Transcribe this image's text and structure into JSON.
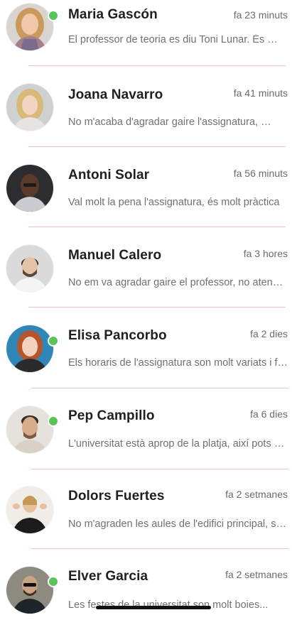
{
  "accent_colors": {
    "online": "#58c558",
    "divider": "#f1c4c4"
  },
  "conversations": [
    {
      "name": "Maria Gascón",
      "time": "fa 23 minuts",
      "preview": "El professor de teoria es diu Toni Lunar. És molt simpàtic",
      "online": true,
      "avatar": "woman-blonde-smiling-avatar"
    },
    {
      "name": "Joana Navarro",
      "time": "fa 41 minuts",
      "preview": "No m'acaba d'agradar gaire l'assignatura, però és interessant",
      "online": false,
      "avatar": "woman-blonde-avatar"
    },
    {
      "name": "Antoni Solar",
      "time": "fa 56 minuts",
      "preview": "Val molt la pena l'assignatura, és molt pràctica",
      "online": false,
      "avatar": "man-dark-skin-avatar"
    },
    {
      "name": "Manuel Calero",
      "time": "fa 3 hores",
      "preview": "No em va agradar gaire el professor, no atenia els alumnes",
      "online": false,
      "avatar": "man-beard-avatar"
    },
    {
      "name": "Elisa Pancorbo",
      "time": "fa 2 dies",
      "preview": "Els horaris de l'assignatura son molt variats i flexibles",
      "online": true,
      "avatar": "woman-red-hair-avatar"
    },
    {
      "name": "Pep Campillo",
      "time": "fa 6 dies",
      "preview": "L'universitat està aprop de la platja, així pots anar-hi",
      "online": true,
      "avatar": "man-young-avatar"
    },
    {
      "name": "Dolors Fuertes",
      "time": "fa 2 setmanes",
      "preview": "No m'agraden les aules de l'edifici principal, són petites",
      "online": false,
      "avatar": "woman-gesturing-avatar"
    },
    {
      "name": "Elver Garcia",
      "time": "fa 2 setmanes",
      "preview": "Les festes de la universitat son molt boies...",
      "online": true,
      "avatar": "man-sunglasses-avatar"
    }
  ]
}
